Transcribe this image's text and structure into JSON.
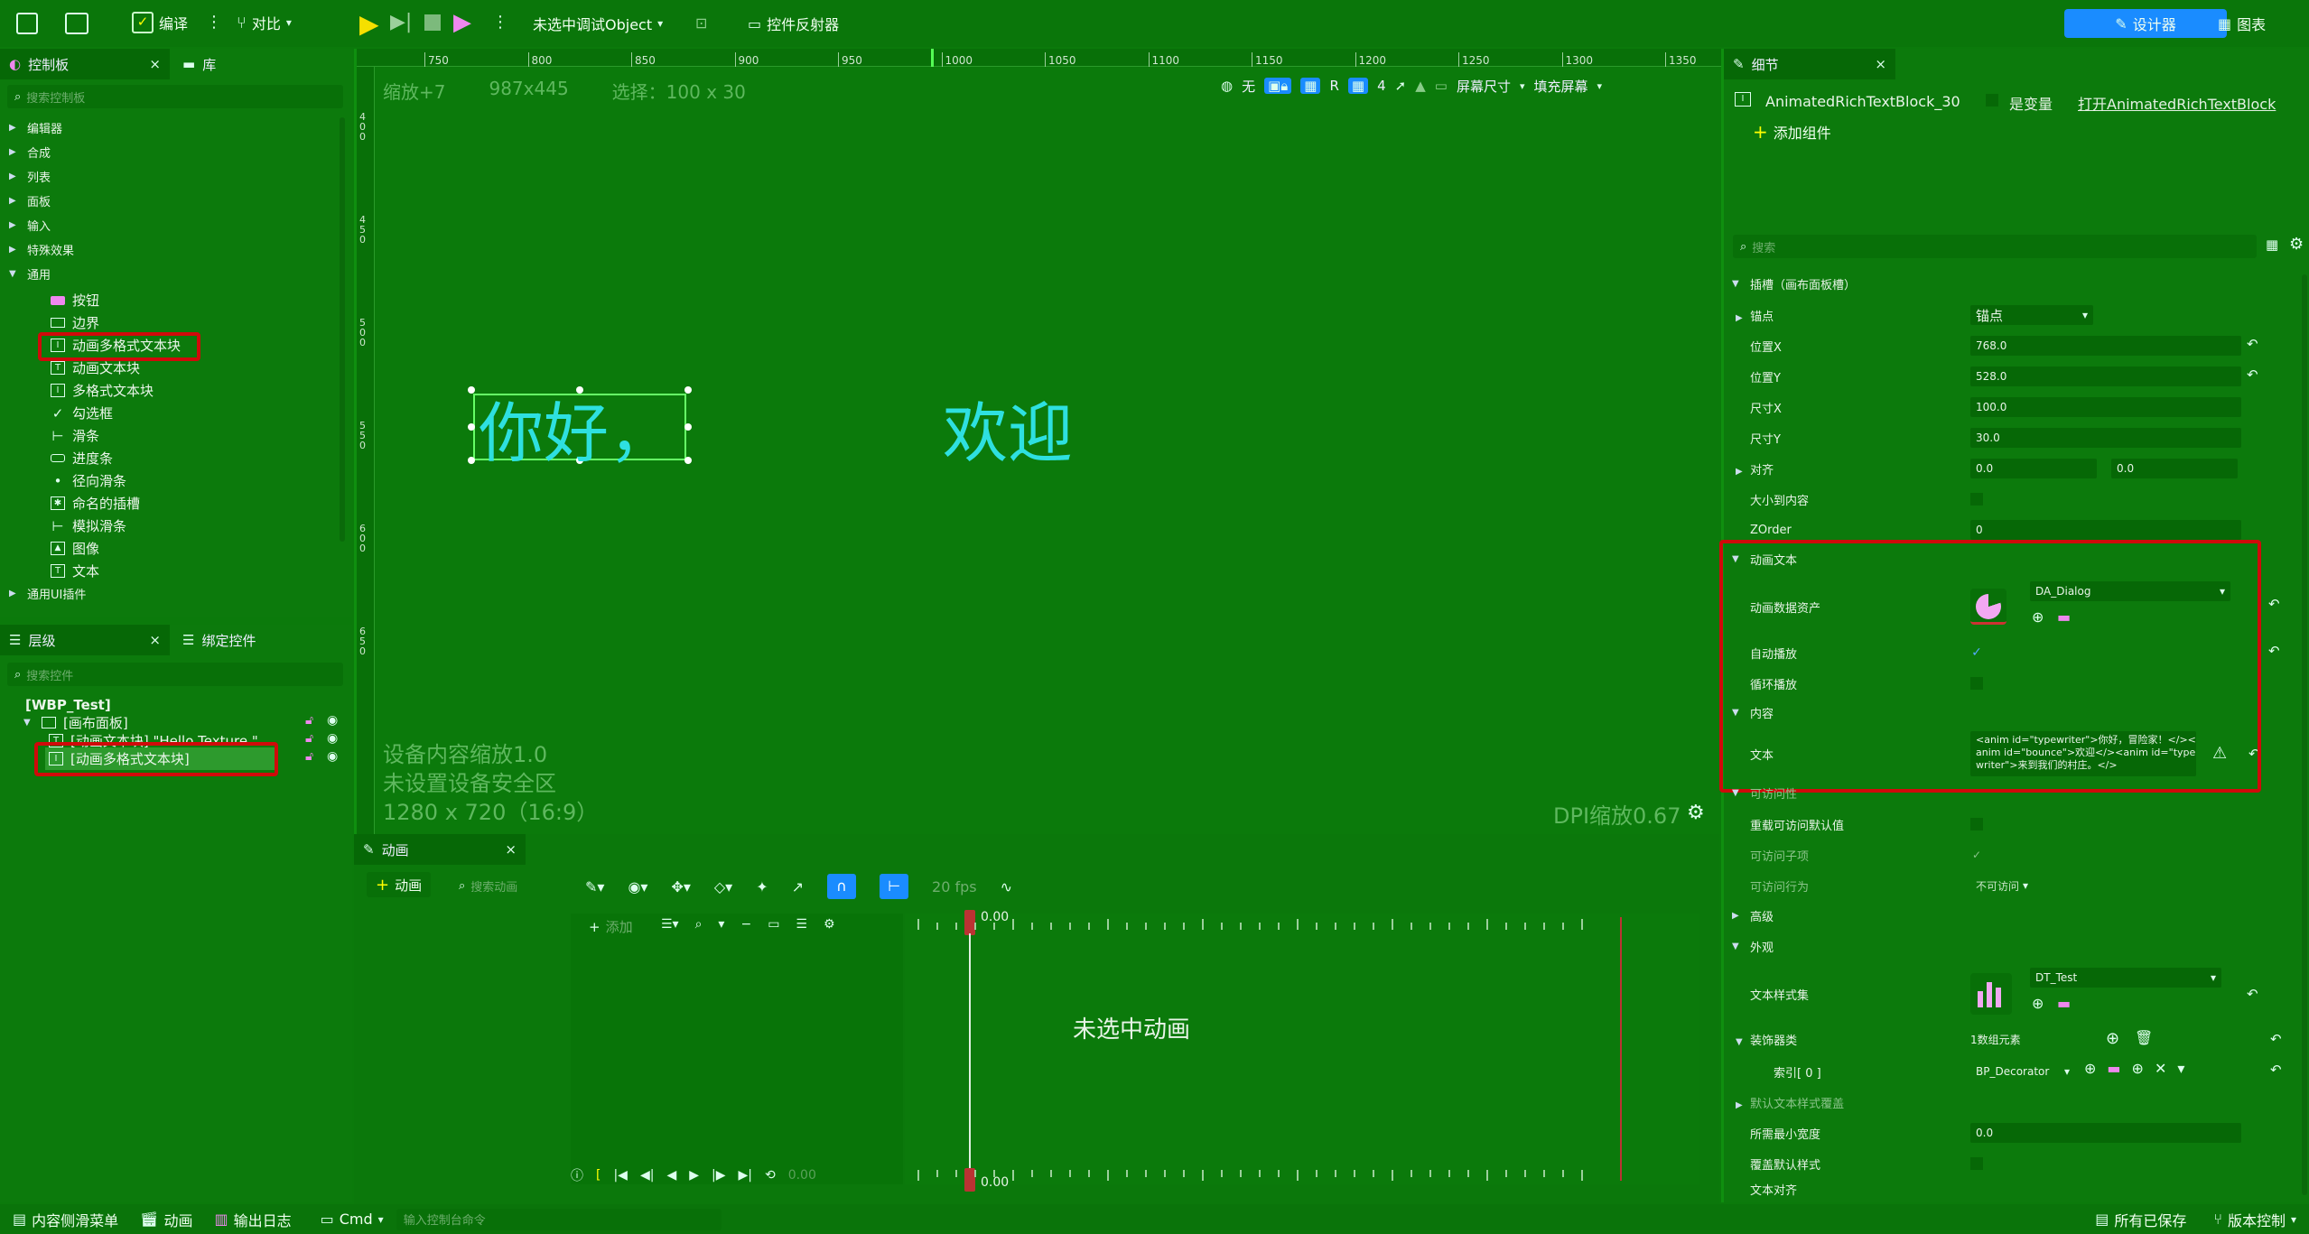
{
  "toolbar": {
    "compile_label": "编译",
    "diff_label": "对比",
    "debug_object": "未选中调试Object",
    "widget_reflector": "控件反射器",
    "designer_label": "设计器",
    "graph_label": "图表"
  },
  "palette": {
    "tab_label": "控制板",
    "library_tab": "库",
    "search_placeholder": "搜索控制板",
    "categories": [
      "编辑器",
      "合成",
      "列表",
      "面板",
      "输入",
      "特殊效果",
      "通用"
    ],
    "common_items": [
      "按钮",
      "边界",
      "动画多格式文本块",
      "动画文本块",
      "多格式文本块",
      "勾选框",
      "滑条",
      "进度条",
      "径向滑条",
      "命名的插槽",
      "模拟滑条",
      "图像",
      "文本"
    ],
    "common_ui_plugin": "通用UI插件"
  },
  "hierarchy": {
    "tab_label": "层级",
    "bind_tab": "绑定控件",
    "search_placeholder": "搜索控件",
    "root": "[WBP_Test]",
    "canvas": "[画布面板]",
    "text_block": "[动画文本块] \"Hello Texture \"",
    "rich_block": "[动画多格式文本块]"
  },
  "viewport": {
    "zoom": "缩放+7",
    "size": "987x445",
    "selection": "选择：100 x 30",
    "none_label": "无",
    "r_label": "R",
    "grid_value": "4",
    "screen_size": "屏幕尺寸",
    "fill_screen": "填充屏幕",
    "canvas_text_1": "你好，",
    "canvas_text_2": "欢迎",
    "device_scale": "设备内容缩放1.0",
    "safe_zone": "未设置设备安全区",
    "resolution": "1280 x 720（16:9）",
    "dpi_scale": "DPI缩放0.67",
    "ruler_numbers": [
      "750",
      "800",
      "850",
      "900",
      "950",
      "1000",
      "1050",
      "1100",
      "1150",
      "1200",
      "1250",
      "1300",
      "1350"
    ],
    "vruler_numbers": [
      "400",
      "450",
      "500",
      "550",
      "600",
      "650"
    ]
  },
  "animation": {
    "tab_label": "动画",
    "add_anim": "动画",
    "search_placeholder": "搜索动画",
    "add_track": "添加",
    "fps": "20 fps",
    "time_top": "0.00",
    "time_bottom": "0.00",
    "time_left": "0.00",
    "no_anim": "未选中动画"
  },
  "details": {
    "tab_label": "细节",
    "widget_name": "AnimatedRichTextBlock_30",
    "is_variable": "是变量",
    "open_link": "打开AnimatedRichTextBlock",
    "add_component": "添加组件",
    "search_placeholder": "搜索",
    "slot_section": "插槽（画布面板槽）",
    "anchors": "锚点",
    "anchors_value": "锚点",
    "pos_x": "位置X",
    "pos_x_value": "768.0",
    "pos_y": "位置Y",
    "pos_y_value": "528.0",
    "size_x": "尺寸X",
    "size_x_value": "100.0",
    "size_y": "尺寸Y",
    "size_y_value": "30.0",
    "alignment": "对齐",
    "align_x": "0.0",
    "align_y": "0.0",
    "size_to_content": "大小到内容",
    "zorder": "ZOrder",
    "zorder_value": "0",
    "anim_text_section": "动画文本",
    "anim_data_asset": "动画数据资产",
    "anim_asset_value": "DA_Dialog",
    "autoplay": "自动播放",
    "loop": "循环播放",
    "content_section": "内容",
    "text_label": "文本",
    "text_value": "<anim id=\"typewriter\">你好，冒险家！</><anim id=\"bounce\">欢迎</><anim id=\"typewriter\">来到我们的村庄。</>",
    "accessibility": "可访问性",
    "override_access": "重载可访问默认值",
    "can_children": "可访问子项",
    "access_behavior": "可访问行为",
    "access_behavior_value": "不可访问",
    "advanced": "高级",
    "appearance": "外观",
    "text_style_set": "文本样式集",
    "text_style_value": "DT_Test",
    "decorator_classes": "装饰器类",
    "decorator_count": "1数组元素",
    "index0": "索引[ 0 ]",
    "decorator_value": "BP_Decorator",
    "default_text_style": "默认文本样式覆盖",
    "min_width": "所需最小宽度",
    "min_width_value": "0.0",
    "override_default": "覆盖默认样式",
    "justification": "文本对齐"
  },
  "statusbar": {
    "content_drawer": "内容侧滑菜单",
    "animation": "动画",
    "output_log": "输出日志",
    "cmd": "Cmd",
    "console_placeholder": "输入控制台命令",
    "all_saved": "所有已保存",
    "source_control": "版本控制"
  },
  "colors": {
    "background": "#0b7a0b",
    "accent": "#1a8cff",
    "canvas_text": "#2ee0e0",
    "highlight_box": "#d00a0a",
    "selection": "#2d9a2d"
  }
}
